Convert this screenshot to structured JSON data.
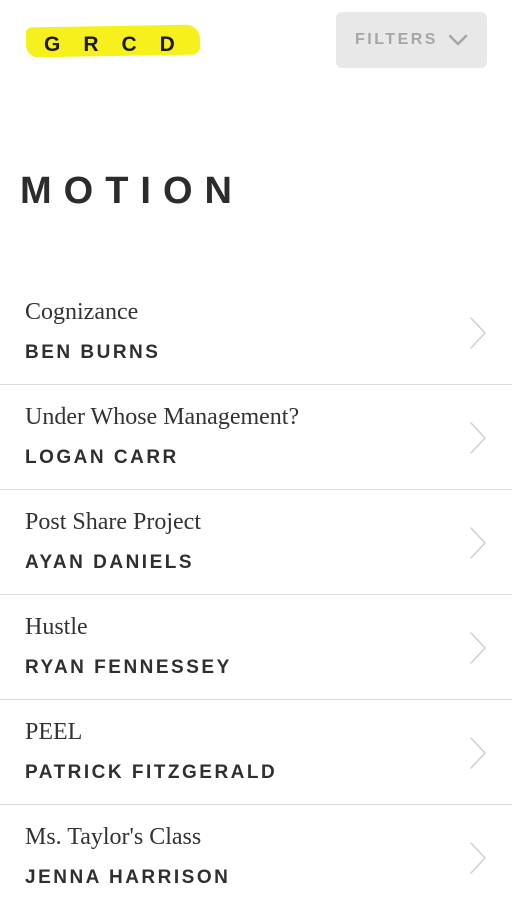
{
  "header": {
    "logo_text": "GRCD",
    "filters_label": "FILTERS",
    "filters_icon": "chevron-down-icon",
    "logo_highlight_color": "#f6f01c"
  },
  "page": {
    "title": "MOTION"
  },
  "films": [
    {
      "title": "Cognizance",
      "author": "BEN BURNS"
    },
    {
      "title": "Under Whose Management?",
      "author": "LOGAN CARR"
    },
    {
      "title": "Post Share Project",
      "author": "AYAN DANIELS"
    },
    {
      "title": "Hustle",
      "author": "RYAN FENNESSEY"
    },
    {
      "title": "PEEL",
      "author": "PATRICK FITZGERALD"
    },
    {
      "title": "Ms. Taylor's Class",
      "author": "JENNA HARRISON"
    }
  ],
  "row_icon": "chevron-right-icon"
}
